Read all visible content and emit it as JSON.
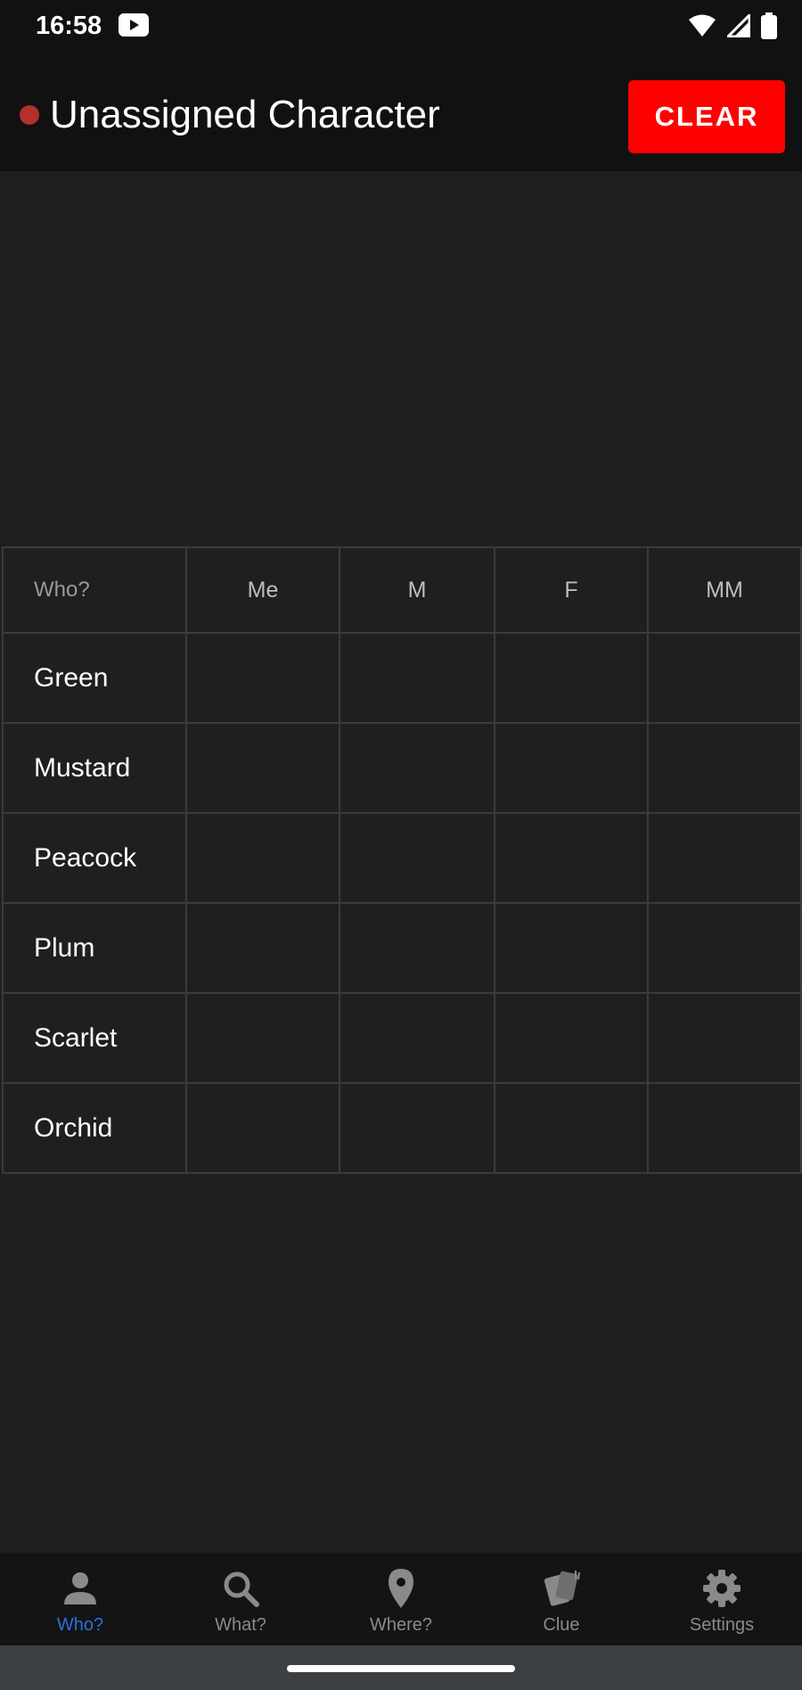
{
  "status_bar": {
    "time": "16:58"
  },
  "app_bar": {
    "title": "Unassigned Character",
    "clear_label": "CLEAR",
    "dot_color": "#b3302c",
    "clear_color": "#ff0000"
  },
  "grid": {
    "header": [
      "Who?",
      "Me",
      "M",
      "F",
      "MM"
    ],
    "rows": [
      {
        "name": "Green"
      },
      {
        "name": "Mustard"
      },
      {
        "name": "Peacock"
      },
      {
        "name": "Plum"
      },
      {
        "name": "Scarlet"
      },
      {
        "name": "Orchid"
      }
    ]
  },
  "bottom_nav": {
    "items": [
      {
        "label": "Who?",
        "icon": "person-icon",
        "active": true
      },
      {
        "label": "What?",
        "icon": "search-icon",
        "active": false
      },
      {
        "label": "Where?",
        "icon": "location-pin-icon",
        "active": false
      },
      {
        "label": "Clue",
        "icon": "cards-icon",
        "active": false
      },
      {
        "label": "Settings",
        "icon": "gear-icon",
        "active": false
      }
    ],
    "active_color": "#2d6fe0"
  }
}
